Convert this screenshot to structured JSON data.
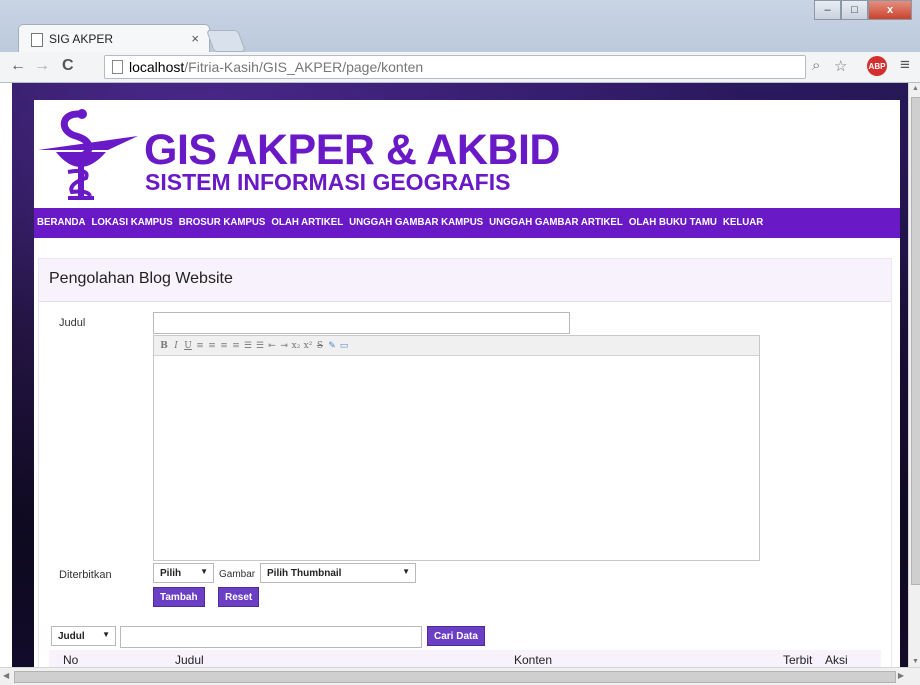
{
  "browser": {
    "tab_title": "SIG AKPER",
    "tab_close": "×",
    "url_host": "localhost",
    "url_path": "/Fitria-Kasih/GIS_AKPER/page/konten",
    "abp_label": "ABP",
    "window_buttons": {
      "minimize": "–",
      "maximize": "□",
      "close": "x"
    },
    "nav": {
      "back": "←",
      "forward": "→",
      "reload": "C"
    },
    "tools": {
      "zoom": "⌕",
      "star": "☆",
      "menu": "≡"
    }
  },
  "site": {
    "title": "GIS AKPER & AKBID",
    "subtitle": "SISTEM INFORMASI GEOGRAFIS",
    "brand_color": "#6a19c7"
  },
  "menu": [
    {
      "label": "BERANDA"
    },
    {
      "label": "LOKASI KAMPUS"
    },
    {
      "label": "BROSUR KAMPUS"
    },
    {
      "label": "OLAH ARTIKEL"
    },
    {
      "label": "UNGGAH GAMBAR KAMPUS"
    },
    {
      "label": "UNGGAH GAMBAR ARTIKEL"
    },
    {
      "label": "OLAH BUKU TAMU"
    },
    {
      "label": "KELUAR"
    }
  ],
  "panel": {
    "title": "Pengolahan Blog Website",
    "form": {
      "judul_label": "Judul",
      "judul_value": "",
      "diterbitkan_label": "Diterbitkan",
      "diterbitkan_value": "Pilih",
      "gambar_label": "Gambar",
      "gambar_value": "Pilih Thumbnail",
      "tambah_label": "Tambah",
      "reset_label": "Reset"
    },
    "editor_toolbar": [
      "B",
      "I",
      "U",
      "≡",
      "≡",
      "≡",
      "≡",
      "☰",
      "☰",
      "⇤",
      "⇥",
      "x₂",
      "x²",
      "S",
      "✎",
      "▭"
    ],
    "search": {
      "field_value": "Judul",
      "query_value": "",
      "button_label": "Cari Data"
    },
    "table_headers": [
      "No",
      "Judul",
      "Konten",
      "Terbit",
      "Aksi"
    ]
  }
}
